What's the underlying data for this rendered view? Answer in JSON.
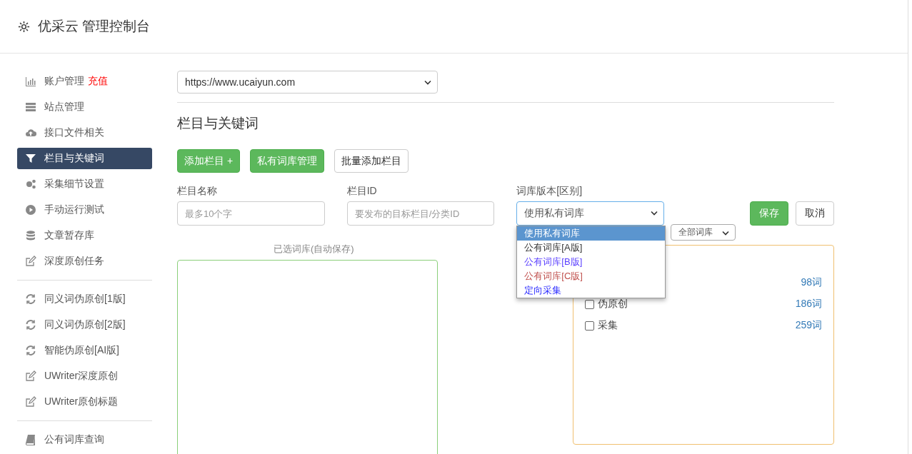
{
  "header": {
    "title": "优采云 管理控制台"
  },
  "sidebar": {
    "groups": [
      [
        {
          "label": "账户管理",
          "badge": "充值",
          "selected": false
        },
        {
          "label": "站点管理",
          "selected": false
        },
        {
          "label": "接口文件相关",
          "selected": false
        },
        {
          "label": "栏目与关键词",
          "selected": true
        },
        {
          "label": "采集细节设置",
          "selected": false
        },
        {
          "label": "手动运行测试",
          "selected": false
        },
        {
          "label": "文章暂存库",
          "selected": false
        },
        {
          "label": "深度原创任务",
          "selected": false
        }
      ],
      [
        {
          "label": "同义词伪原创[1版]",
          "selected": false
        },
        {
          "label": "同义词伪原创[2版]",
          "selected": false
        },
        {
          "label": "智能伪原创[AI版]",
          "selected": false
        },
        {
          "label": "UWriter深度原创",
          "selected": false
        },
        {
          "label": "UWriter原创标题",
          "selected": false
        }
      ],
      [
        {
          "label": "公有词库查询",
          "selected": false
        }
      ]
    ]
  },
  "site_select": {
    "value": "https://www.ucaiyun.com"
  },
  "section_title": "栏目与关键词",
  "buttons": [
    {
      "label": "添加栏目 +",
      "kind": "primary"
    },
    {
      "label": "私有词库管理",
      "kind": "primary"
    },
    {
      "label": "批量添加栏目",
      "kind": "default"
    }
  ],
  "form": {
    "fields": [
      {
        "label": "栏目名称",
        "placeholder": "最多10个字",
        "kind": "input"
      },
      {
        "label": "栏目ID",
        "placeholder": "要发布的目标栏目/分类ID",
        "kind": "input"
      },
      {
        "label": "词库版本[区别]",
        "value": "使用私有词库",
        "kind": "select"
      }
    ],
    "save": "保存",
    "cancel": "取消"
  },
  "dropdown": {
    "options": [
      {
        "label": "使用私有词库",
        "selected": true
      },
      {
        "label": "公有词库[A版]",
        "selected": false,
        "color": "#333333"
      },
      {
        "label": "公有词库[B版]",
        "selected": false,
        "color": "#5a3fff"
      },
      {
        "label": "公有词库[C版]",
        "selected": false,
        "color": "#c0504d"
      },
      {
        "label": "定向采集",
        "selected": false,
        "color": "#2a2aff"
      }
    ]
  },
  "selected_label": "已选词库(自动保存)",
  "library_filter": {
    "value": "全部词库"
  },
  "libraries": [
    {
      "count": "98词"
    },
    {
      "name": "伪原创",
      "count": "186词",
      "checked": false
    },
    {
      "name": "采集",
      "count": "259词",
      "checked": false
    }
  ]
}
